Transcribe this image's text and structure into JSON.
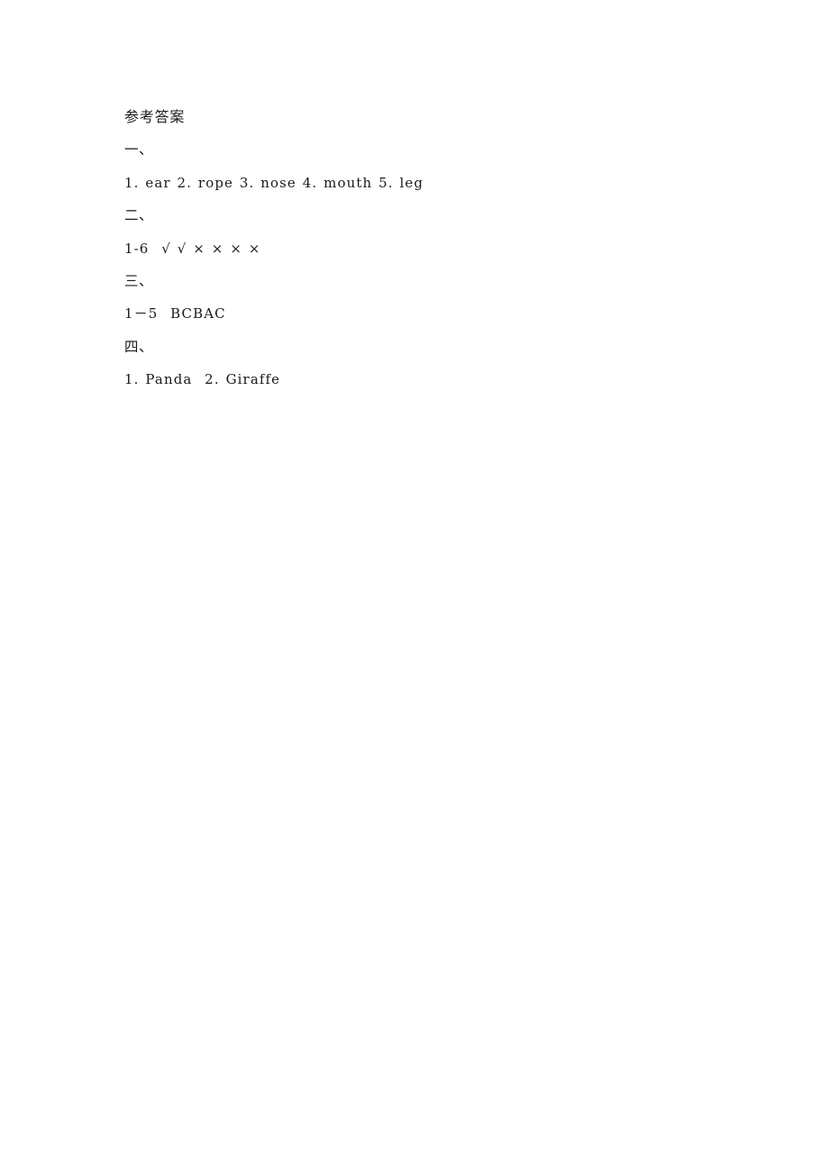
{
  "document": {
    "title": "参考答案",
    "background_color": "#ffffff",
    "text_color": "#1a1a1a"
  },
  "sections": [
    {
      "marker": "一、",
      "answer": "1. ear 2. rope 3. nose 4. mouth 5. leg"
    },
    {
      "marker": "二、",
      "range": "1-6",
      "marks": "√ √ × × × ×",
      "answer": "1-6  √ √ × × × ×"
    },
    {
      "marker": "三、",
      "range": "1－5",
      "answer": "1－5  BCBAC"
    },
    {
      "marker": "四、",
      "answer": "1. Panda  2. Giraffe"
    }
  ]
}
